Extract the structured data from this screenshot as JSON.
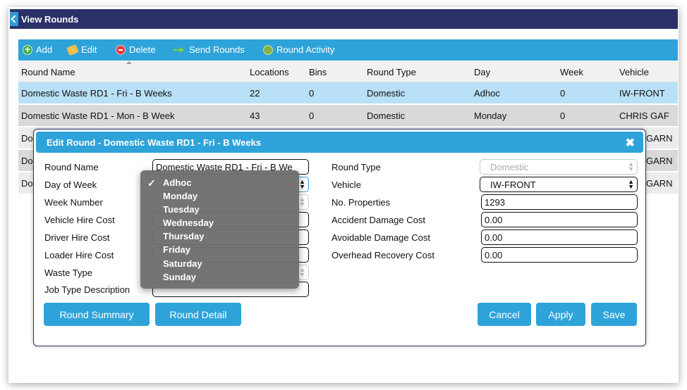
{
  "window": {
    "title": "View Rounds"
  },
  "toolbar": {
    "add": "Add",
    "edit": "Edit",
    "delete": "Delete",
    "send_rounds": "Send Rounds",
    "round_activity": "Round Activity"
  },
  "table": {
    "columns": [
      "Round Name",
      "Locations",
      "Bins",
      "Round Type",
      "Day",
      "Week",
      "Vehicle"
    ],
    "rows": [
      [
        "Domestic Waste RD1 - Fri - B Weeks",
        "22",
        "0",
        "Domestic",
        "Adhoc",
        "0",
        "IW-FRONT"
      ],
      [
        "Domestic Waste RD1 - Mon - B Week",
        "43",
        "0",
        "Domestic",
        "Monday",
        "0",
        "CHRIS GAF"
      ],
      [
        "Do",
        "",
        "",
        "",
        "",
        "",
        "GARN"
      ],
      [
        "Do",
        "",
        "",
        "",
        "",
        "",
        "GARN"
      ],
      [
        "Do",
        "",
        "",
        "",
        "",
        "",
        "GARN"
      ]
    ]
  },
  "dialog": {
    "title": "Edit Round - Domestic Waste RD1 - Fri - B Weeks",
    "close": "✖",
    "left_labels": [
      "Round Name",
      "Day of Week",
      "Week Number",
      "Vehicle Hire Cost",
      "Driver Hire Cost",
      "Loader Hire Cost",
      "Waste Type",
      "Job Type Description"
    ],
    "round_name_value": "Domestic Waste RD1 - Fri - B We",
    "right_labels": [
      "Round Type",
      "Vehicle",
      "No. Properties",
      "Accident Damage Cost",
      "Avoidable Damage Cost",
      "Overhead Recovery Cost"
    ],
    "round_type_value": "Domestic",
    "vehicle_value": "IW-FRONT",
    "no_properties_value": "1293",
    "accident_damage_value": "0.00",
    "avoidable_damage_value": "0.00",
    "overhead_recovery_value": "0.00",
    "buttons": {
      "round_summary": "Round Summary",
      "round_detail": "Round Detail",
      "cancel": "Cancel",
      "apply": "Apply",
      "save": "Save"
    }
  },
  "day_dropdown": {
    "options": [
      "Adhoc",
      "Monday",
      "Tuesday",
      "Wednesday",
      "Thursday",
      "Friday",
      "Saturday",
      "Sunday"
    ],
    "selected": "Adhoc",
    "check": "✓"
  },
  "colors": {
    "titlebar": "#2b3069",
    "accent": "#2ea3d9",
    "selected_row": "#b9e0f6"
  },
  "icons": {
    "back": "chevron-left-icon",
    "add": "add-circle-icon",
    "edit": "edit-pencil-icon",
    "delete": "delete-circle-icon",
    "send": "send-arrow-icon",
    "activity": "activity-icon"
  }
}
